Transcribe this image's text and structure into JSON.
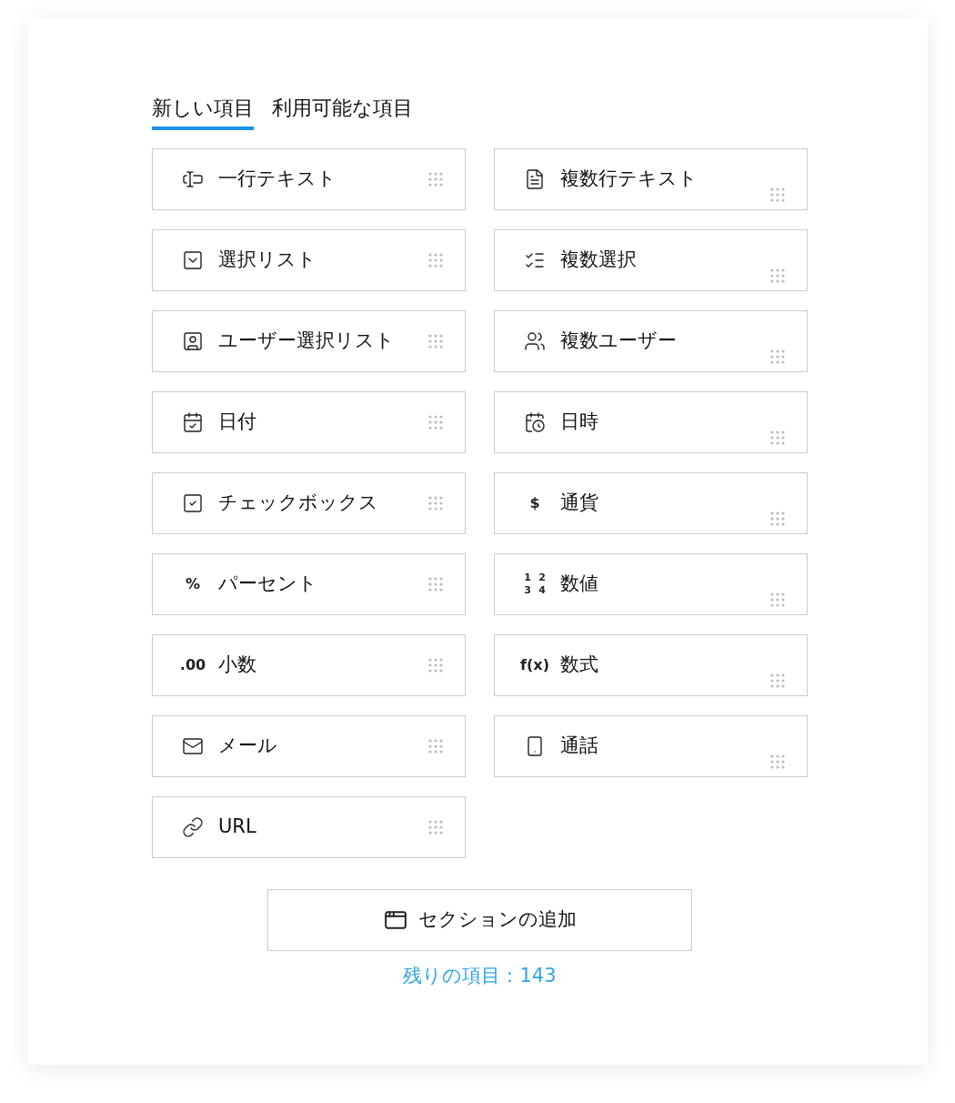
{
  "tabs": [
    {
      "label": "新しい項目",
      "selected": true
    },
    {
      "label": "利用可能な項目",
      "selected": false
    }
  ],
  "fields": [
    {
      "label": "一行テキスト",
      "kind": "text"
    },
    {
      "label": "複数行テキスト",
      "kind": "textarea"
    },
    {
      "label": "選択リスト",
      "kind": "select"
    },
    {
      "label": "複数選択",
      "kind": "multiselect"
    },
    {
      "label": "ユーザー選択リスト",
      "kind": "user"
    },
    {
      "label": "複数ユーザー",
      "kind": "users"
    },
    {
      "label": "日付",
      "kind": "date"
    },
    {
      "label": "日時",
      "kind": "datetime"
    },
    {
      "label": "チェックボックス",
      "kind": "checkbox"
    },
    {
      "label": "通貨",
      "kind": "glyph",
      "glyph": "$"
    },
    {
      "label": "パーセント",
      "kind": "glyph",
      "glyph": "%"
    },
    {
      "label": "数値",
      "kind": "grid",
      "glyphs": [
        "1",
        "2",
        "3",
        "4"
      ]
    },
    {
      "label": "小数",
      "kind": "glyph",
      "glyph": ".00"
    },
    {
      "label": "数式",
      "kind": "glyph",
      "glyph": "f(x)"
    },
    {
      "label": "メール",
      "kind": "email"
    },
    {
      "label": "通話",
      "kind": "phone"
    },
    {
      "label": "URL",
      "kind": "url"
    }
  ],
  "add_section": {
    "label": "セクションの追加"
  },
  "remaining": "残りの項目：143"
}
